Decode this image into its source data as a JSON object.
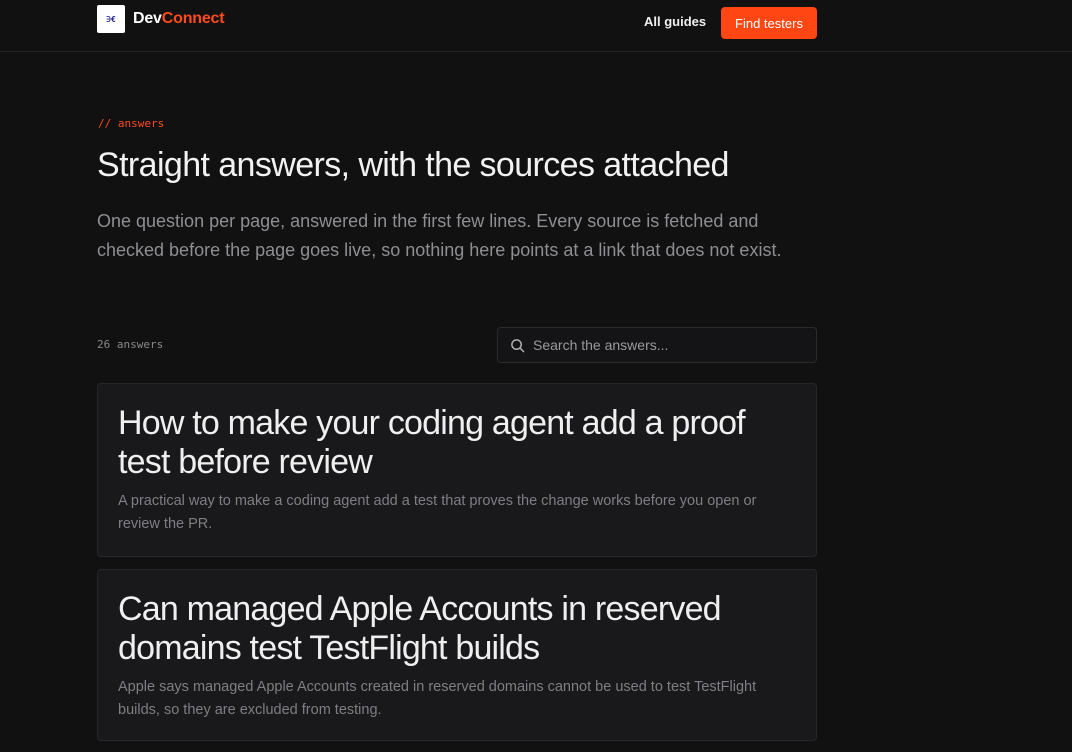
{
  "header": {
    "brand_dev": "Dev",
    "brand_connect": "Connect",
    "logo_glyph": "∋€",
    "nav_label": "All guides",
    "cta_label": "Find testers",
    "accent_color": "#ff4613"
  },
  "hero": {
    "eyebrow": "// answers",
    "title": "Straight answers, with the sources attached",
    "lede": "One question per page, answered in the first few lines. Every source is fetched and checked before the page goes live, so nothing here points at a link that does not exist."
  },
  "list": {
    "count": "26 answers",
    "search_placeholder": "Search the answers..."
  },
  "cards": [
    {
      "title": "How to make your coding agent add a proof test before review",
      "desc": "A practical way to make a coding agent add a test that proves the change works before you open or review the PR."
    },
    {
      "title": "Can managed Apple Accounts in reserved domains test TestFlight builds",
      "desc": "Apple says managed Apple Accounts created in reserved domains cannot be used to test TestFlight builds, so they are excluded from testing."
    }
  ]
}
